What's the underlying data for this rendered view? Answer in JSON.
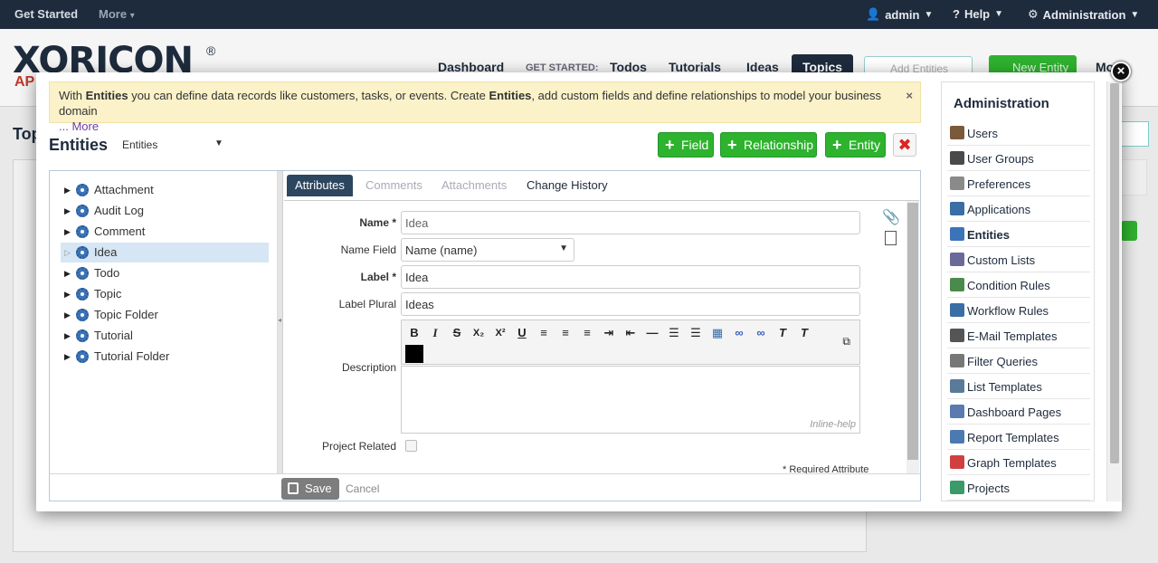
{
  "topbar": {
    "get_started": "Get Started",
    "more": "More",
    "user": "admin",
    "help": "Help",
    "administration": "Administration"
  },
  "background": {
    "logo_text": "XORICON",
    "logo_reg": "®",
    "logo_sub": "AP",
    "nav": {
      "dashboard": "Dashboard",
      "get_started_label": "GET STARTED:",
      "todos": "Todos",
      "tutorials": "Tutorials",
      "ideas": "Ideas",
      "topics": "Topics",
      "search_placeholder": "Add Entities",
      "new_entity": "New Entity",
      "more": "Mo"
    },
    "page_title": "Top"
  },
  "modal": {
    "banner": {
      "text_1": "With ",
      "bold_1": "Entities",
      "text_2": " you can define data records like customers, tasks, or events. Create ",
      "bold_2": "Entities",
      "text_3": ", add custom fields and define relationships to model your business domain",
      "more": "... More",
      "close": "×"
    },
    "title": "Entities",
    "filter_select": "Entities",
    "buttons": {
      "field": "Field",
      "relationship": "Relationship",
      "entity": "Entity",
      "delete": "✖"
    },
    "tree": [
      {
        "label": "Attachment",
        "selected": false
      },
      {
        "label": "Audit Log",
        "selected": false
      },
      {
        "label": "Comment",
        "selected": false
      },
      {
        "label": "Idea",
        "selected": true
      },
      {
        "label": "Todo",
        "selected": false
      },
      {
        "label": "Topic",
        "selected": false
      },
      {
        "label": "Topic Folder",
        "selected": false
      },
      {
        "label": "Tutorial",
        "selected": false
      },
      {
        "label": "Tutorial Folder",
        "selected": false
      }
    ],
    "tabs": {
      "attributes": "Attributes",
      "comments": "Comments",
      "attachments": "Attachments",
      "history": "Change History"
    },
    "form": {
      "name_label": "Name *",
      "name_value": "Idea",
      "name_field_label": "Name Field",
      "name_field_value": "Name (name)",
      "label_label": "Label *",
      "label_value": "Idea",
      "label_plural_label": "Label Plural",
      "label_plural_value": "Ideas",
      "description_label": "Description",
      "inline_help": "Inline-help",
      "project_related_label": "Project Related",
      "project_related_checked": false,
      "required_note": "* Required Attribute"
    },
    "toolbar_glyphs": [
      "B",
      "I",
      "S",
      "X₂",
      "X²",
      "U",
      "≡",
      "≡",
      "≡",
      "⇥",
      "⇤",
      "—",
      "☰",
      "☰",
      "▦",
      "∞",
      "∞",
      "T",
      "T"
    ],
    "footer": {
      "save": "Save",
      "cancel": "Cancel"
    }
  },
  "admin_panel": {
    "title": "Administration",
    "items": [
      {
        "label": "Users",
        "icon": "user-icon",
        "color": "#7a5a3a"
      },
      {
        "label": "User Groups",
        "icon": "user-group-icon",
        "color": "#4a4a4a"
      },
      {
        "label": "Preferences",
        "icon": "tools-icon",
        "color": "#8a8a8a"
      },
      {
        "label": "Applications",
        "icon": "window-icon",
        "color": "#3a6ea5"
      },
      {
        "label": "Entities",
        "icon": "gear-icon",
        "color": "#3b74b8"
      },
      {
        "label": "Custom Lists",
        "icon": "list-edit-icon",
        "color": "#6a6a9a"
      },
      {
        "label": "Condition Rules",
        "icon": "condition-icon",
        "color": "#4a8a4a"
      },
      {
        "label": "Workflow Rules",
        "icon": "workflow-icon",
        "color": "#3a6ea5"
      },
      {
        "label": "E-Mail Templates",
        "icon": "envelope-icon",
        "color": "#555555"
      },
      {
        "label": "Filter Queries",
        "icon": "filter-icon",
        "color": "#777777"
      },
      {
        "label": "List Templates",
        "icon": "list-icon",
        "color": "#5a7a9a"
      },
      {
        "label": "Dashboard Pages",
        "icon": "dashboard-icon",
        "color": "#5a7ab0"
      },
      {
        "label": "Report Templates",
        "icon": "report-icon",
        "color": "#4a7ab0"
      },
      {
        "label": "Graph Templates",
        "icon": "pie-chart-icon",
        "color": "#d04040"
      },
      {
        "label": "Projects",
        "icon": "project-icon",
        "color": "#3a9a6a"
      }
    ]
  }
}
